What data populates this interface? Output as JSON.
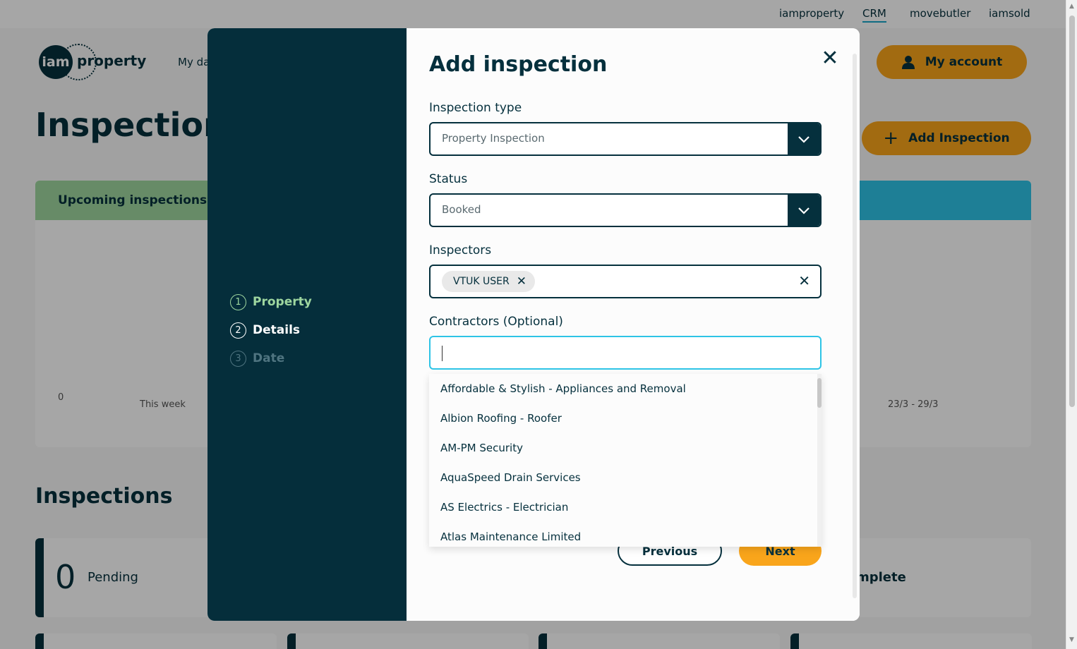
{
  "topbar": {
    "links": [
      "iamproperty",
      "CRM",
      "movebutler",
      "iamsold"
    ]
  },
  "brand": {
    "logo_circle": "iam",
    "logo_word": "property"
  },
  "nav": {
    "my_dashboard": "My da"
  },
  "header": {
    "my_account": "My account",
    "page_title": "Inspections",
    "add_inspection": "Add Inspection"
  },
  "upcoming": {
    "title": "Upcoming inspections",
    "y_zero": "0",
    "this_week": "This week",
    "last_range": "23/3 - 29/3"
  },
  "inspections_section": {
    "title": "Inspections",
    "pending_count": "0",
    "pending_label": "Pending",
    "complete_label": "mplete"
  },
  "modal": {
    "title": "Add inspection",
    "steps": [
      {
        "num": "1",
        "label": "Property"
      },
      {
        "num": "2",
        "label": "Details"
      },
      {
        "num": "3",
        "label": "Date"
      }
    ],
    "inspection_type": {
      "label": "Inspection type",
      "value": "Property Inspection"
    },
    "status": {
      "label": "Status",
      "value": "Booked"
    },
    "inspectors": {
      "label": "Inspectors",
      "chips": [
        "VTUK USER"
      ]
    },
    "contractors": {
      "label": "Contractors (Optional)",
      "value": "",
      "options": [
        "Affordable & Stylish - Appliances and Removal",
        "Albion Roofing - Roofer",
        "AM-PM Security",
        "AquaSpeed Drain Services",
        "AS Electrics - Electrician",
        "Atlas Maintenance Limited"
      ]
    },
    "buttons": {
      "previous": "Previous",
      "next": "Next"
    }
  },
  "colors": {
    "navy": "#05303d",
    "orange": "#f9a51b",
    "green": "#9ed69f",
    "cyan": "#2ec4e6"
  }
}
